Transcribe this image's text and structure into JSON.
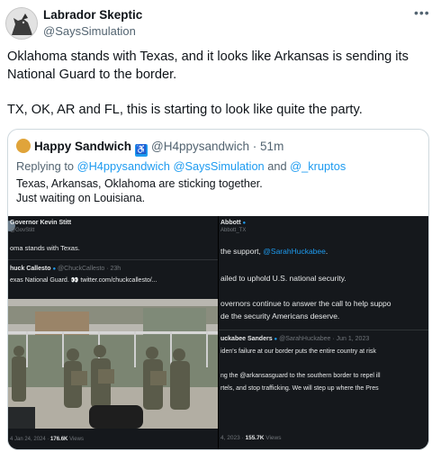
{
  "author": {
    "name": "Labrador Skeptic",
    "handle": "@SaysSimulation"
  },
  "more_label": "•••",
  "tweet": {
    "paragraph_1": "Oklahoma stands with Texas, and it looks like Arkansas is sending its National Guard to the border.",
    "paragraph_2": "TX, OK, AR and FL, this is starting to look like quite the party."
  },
  "quote": {
    "name": "Happy Sandwich",
    "badge": "♿",
    "handle": "@H4ppysandwich",
    "time": "51m",
    "reply_prefix": "Replying to ",
    "reply_user_1": "@H4ppysandwich",
    "reply_user_2": "@SaysSimulation",
    "reply_and": " and ",
    "reply_user_3": "@_kruptos",
    "line_1": "Texas, Arkansas, Oklahoma are sticking together.",
    "line_2": "Just waiting on Louisiana."
  },
  "media": {
    "left": {
      "name": "Governor Kevin Stitt",
      "handle": "@GovStitt",
      "text": "oma stands with Texas.",
      "quote_name": "huck Callesto",
      "quote_handle": "@ChuckCallesto · 23h",
      "quote_text": "exas National Guard. 👀",
      "quote_link": "twitter.com/chuckcallesto/...",
      "date": "4 Jan 24, 2024 · ",
      "views": "176.6K",
      "views_label": " Views"
    },
    "right": {
      "name": "Abbott",
      "handle": "Abbott_TX",
      "line_1_pre": "the support, ",
      "line_1_link": "@SarahHuckabee",
      "line_1_post": ".",
      "line_2": "ailed to uphold U.S. national security.",
      "line_3": "overnors continue to answer the call to help suppo",
      "line_4": "de the security Americans deserve.",
      "quote_name": "uckabee Sanders",
      "quote_handle": "@SarahHuckabee · Jun 1, 2023",
      "quote_line_1": "iden's failure at our border puts the entire country at risk",
      "quote_line_2": "ng the @arkansasguard to the southern border to repel ill",
      "quote_line_3": "rtels, and stop trafficking. We will step up where the Pres",
      "date": "4, 2023 · ",
      "views": "155.7K",
      "views_label": " Views"
    }
  }
}
